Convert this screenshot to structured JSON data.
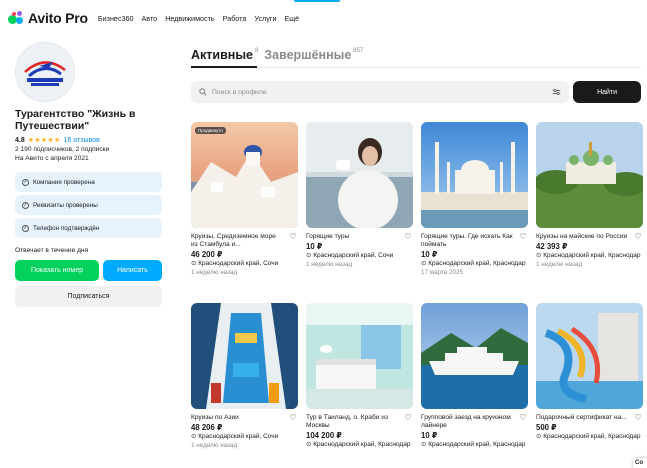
{
  "brand": {
    "name": "Avito Pro",
    "dot_colors": [
      "#02d15c",
      "#965eeb",
      "#00aaff",
      "#ff4053"
    ]
  },
  "nav": [
    "Бизнес360",
    "Авто",
    "Недвижимость",
    "Работа",
    "Услуги",
    "Ещё"
  ],
  "seller": {
    "logo_text": "ЖИЗНЬ В ПУТЕШЕСТВИИ",
    "name": "Турагентство \"Жизнь в Путешествии\"",
    "rating": "4.8",
    "stars": "★★★★★",
    "reviews": "16 отзывов",
    "followers": "2 190 подписчиков, 2 подписки",
    "since": "На Авито с апреля 2021",
    "badges": [
      "Компания проверена",
      "Реквизиты проверены",
      "Телефон подтверждён"
    ],
    "reply": "Отвечает в течение дня",
    "show_phone": "Показать номер",
    "write": "Написать",
    "subscribe": "Подписаться"
  },
  "tabs": {
    "active_label": "Активные",
    "active_count": "8",
    "done_label": "Завершённые",
    "done_count": "857"
  },
  "search": {
    "placeholder": "Поиск в профиле",
    "button": "Найти"
  },
  "listings": [
    {
      "title": "Круизы, Средиземное море из Стамбула и...",
      "price": "46 200 ₽",
      "location": "Краснодарский край, Сочи",
      "date": "1 неделю назад",
      "badge": "Продвинуто"
    },
    {
      "title": "Горящие туры",
      "price": "10 ₽",
      "location": "Краснодарский край, Сочи",
      "date": "1 неделю назад"
    },
    {
      "title": "Горящие туры. Где искать Как поймать",
      "price": "10 ₽",
      "location": "Краснодарский край, Краснодар",
      "date": "17 марта 2025"
    },
    {
      "title": "Круизы на майские по России",
      "price": "42 393 ₽",
      "location": "Краснодарский край, Краснодар",
      "date": "1 неделю назад"
    },
    {
      "title": "Круизы по Азии",
      "price": "48 206 ₽",
      "location": "Краснодарский край, Сочи",
      "date": "1 неделю назад"
    },
    {
      "title": "Тур в Таиланд, о. Краби из Москвы",
      "price": "104 200 ₽",
      "location": "Краснодарский край, Краснодар",
      "date": ""
    },
    {
      "title": "Групповой заезд на круизном лайнере",
      "price": "10 ₽",
      "location": "Краснодарский край, Краснодар",
      "date": ""
    },
    {
      "title": "Подарочный сертификат на...",
      "price": "500 ₽",
      "location": "Краснодарский край, Краснодар",
      "date": ""
    }
  ],
  "location_pin": "⊙",
  "corner_chip": "Co"
}
